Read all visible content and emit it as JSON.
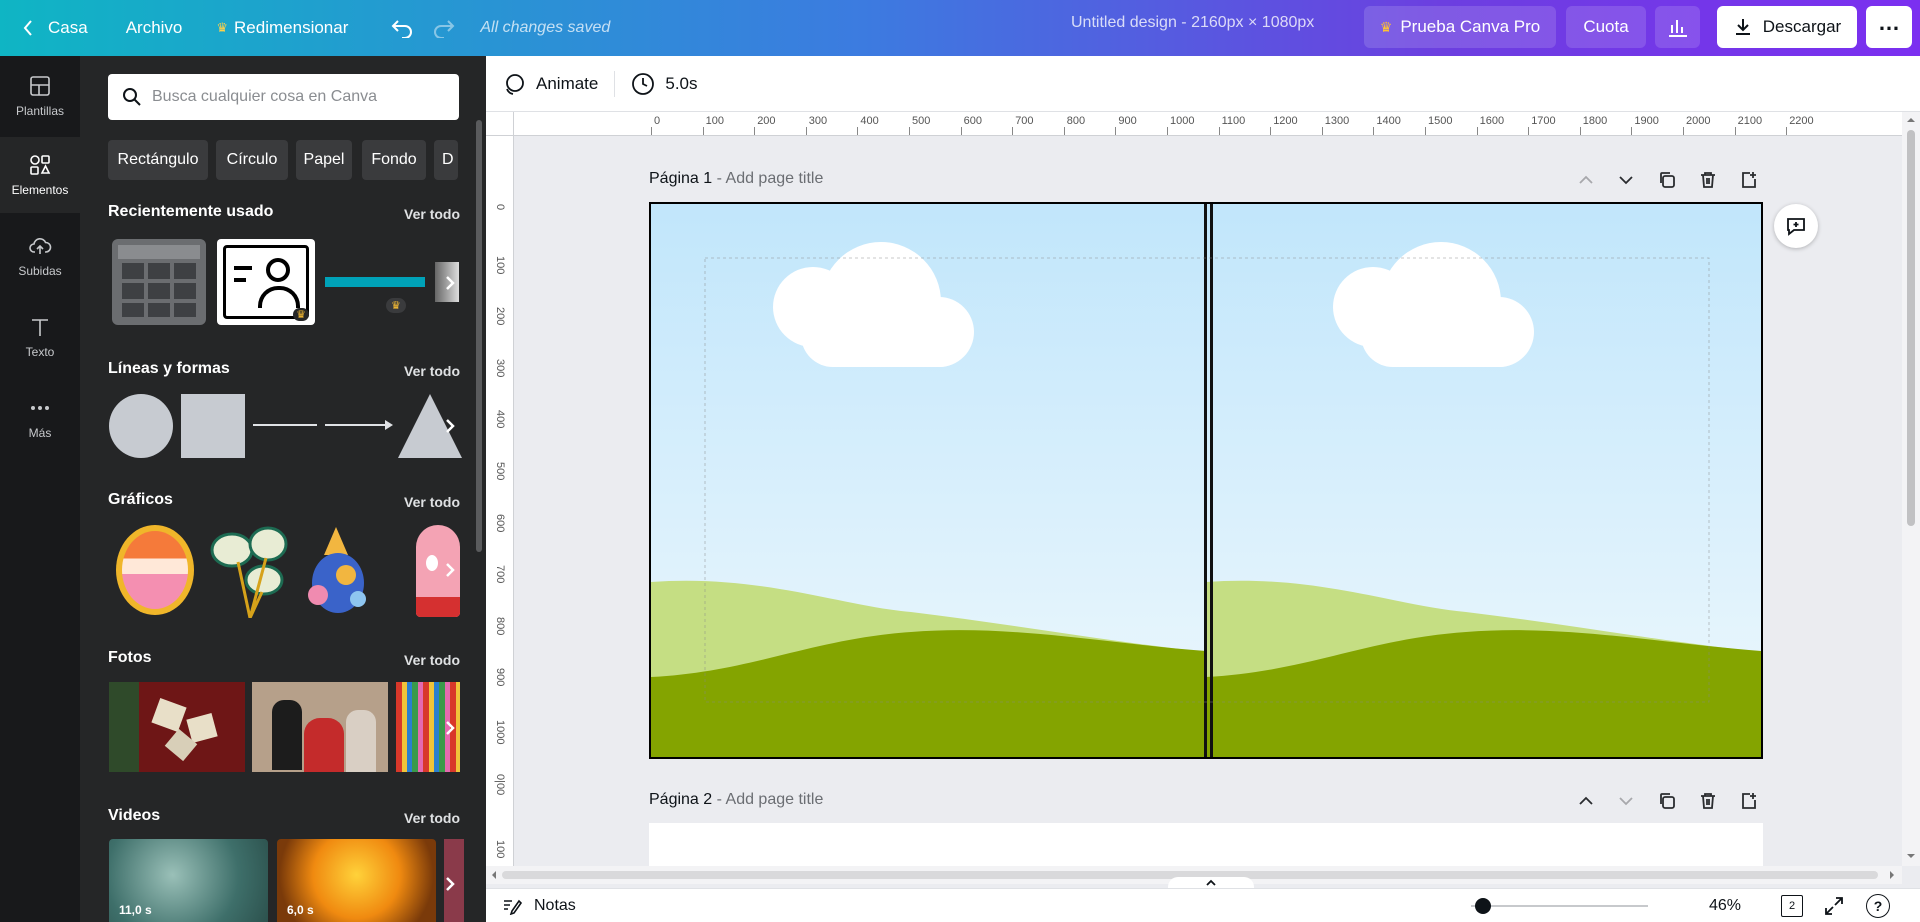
{
  "topbar": {
    "home_label": "Casa",
    "file_label": "Archivo",
    "resize_label": "Redimensionar",
    "saved_status": "All changes saved",
    "design_title": "Untitled design - 2160px × 1080px",
    "pro_label": "Prueba Canva Pro",
    "quota_label": "Cuota",
    "download_label": "Descargar"
  },
  "rail": {
    "items": [
      {
        "label": "Plantillas"
      },
      {
        "label": "Elementos"
      },
      {
        "label": "Subidas"
      },
      {
        "label": "Texto"
      },
      {
        "label": "Más"
      }
    ]
  },
  "panel": {
    "search_placeholder": "Busca cualquier cosa en Canva",
    "chips": [
      "Rectángulo",
      "Círculo",
      "Papel",
      "Fondo",
      "D"
    ],
    "see_all": "Ver todo",
    "sections": {
      "recent": "Recientemente usado",
      "lines": "Líneas y formas",
      "graphics": "Gráficos",
      "photos": "Fotos",
      "videos": "Videos"
    },
    "video_durations": [
      "11,0 s",
      "6,0 s"
    ]
  },
  "toolbar": {
    "animate_label": "Animate",
    "duration_label": "5.0s"
  },
  "ruler": {
    "top": [
      "0",
      "100",
      "200",
      "300",
      "400",
      "500",
      "600",
      "700",
      "800",
      "900",
      "1000",
      "1100",
      "1200",
      "1300",
      "1400",
      "1500",
      "1600",
      "1700",
      "1800",
      "1900",
      "2000",
      "2100",
      "2200"
    ],
    "left": [
      "0",
      "100",
      "200",
      "300",
      "400",
      "500",
      "600",
      "700",
      "800",
      "900",
      "1000",
      "0|00",
      "100"
    ]
  },
  "pages": [
    {
      "label": "Página 1",
      "title_placeholder": "- Add page title"
    },
    {
      "label": "Página 2",
      "title_placeholder": "- Add page title"
    }
  ],
  "bottombar": {
    "notes_label": "Notas",
    "zoom_label": "46%",
    "page_count": "2",
    "help_label": "?"
  },
  "colors": {
    "sky_top": "#c1e6fb",
    "sky_bottom": "#eef8fd",
    "hill_light": "#c5de83",
    "hill_dark": "#84a400",
    "panel_bg": "#252627",
    "rail_bg": "#18191b"
  }
}
